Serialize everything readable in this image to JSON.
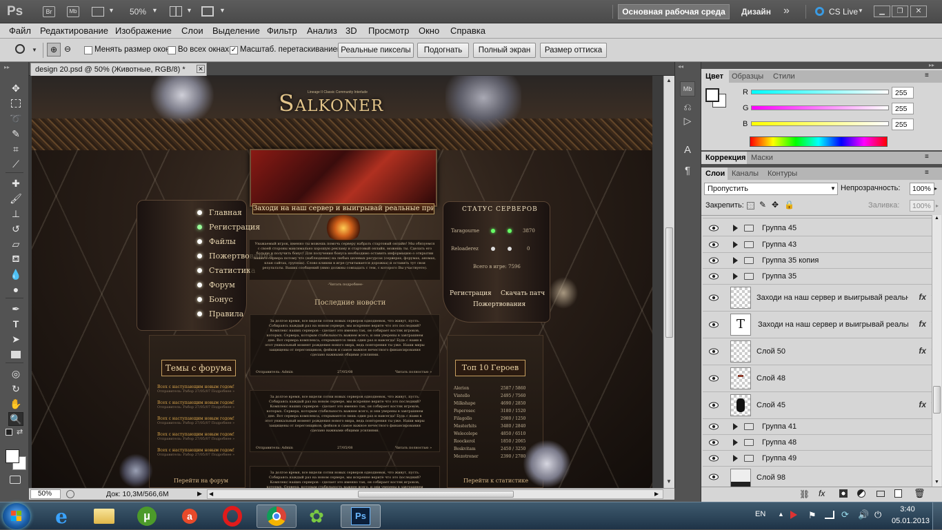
{
  "app": {
    "logo": "Ps",
    "bridge": "Br",
    "minibridge": "Mb",
    "zoom": "50%",
    "workspace_primary": "Основная рабочая среда",
    "workspace_secondary": "Дизайн",
    "cs_live": "CS Live"
  },
  "menu": [
    "Файл",
    "Редактирование",
    "Изображение",
    "Слои",
    "Выделение",
    "Фильтр",
    "Анализ",
    "3D",
    "Просмотр",
    "Окно",
    "Справка"
  ],
  "options": {
    "resize_windows": "Менять размер окон",
    "all_windows": "Во всех окнах",
    "scrubby_zoom": "Масштаб. перетаскиванием",
    "scrubby_checked": true,
    "btn_actual": "Реальные пикселы",
    "btn_fit": "Подогнать",
    "btn_fill": "Полный экран",
    "btn_print": "Размер оттиска"
  },
  "document": {
    "tab_title": "design 20.psd @ 50% (Животные, RGB/8) *",
    "zoom": "50%",
    "doc_size": "Док: 10,3M/566,6M"
  },
  "site": {
    "logo": "Salkoner",
    "tagline": "Lineage II Classic Community Interlude",
    "banner": "Заходи на наш сервер и выигрывай реальные призы!",
    "nav": [
      "Главная",
      "Регистрация",
      "Файлы",
      "Пожертвования",
      "Статистика",
      "Форум",
      "Бонус",
      "Правила"
    ],
    "welcome_text": "Уважаемый игрок, именно ты можешь помочь серверу набрать стартовый онлайн! Мы обязуемся с своей стороны максимально хорошую рекламу и стартовый онлайн, можешь ты. Сделать его больше и получить бонус! Для получения бонуса необходимо оставить информацию о открытии нашего сервера потому что (наблюдение) на любых целевых ресурсах (серверах, форумах, аномах, клан сайтах, группах). Слово кликни в игре (учитывается дорожка) и оставить тут свои результаты. Ваших сообщений (явно должны совпадать с тем, с которого Вы участвуете).",
    "read_more": "-Читать подробнее-",
    "news_title": "Последние новости",
    "news_text": "За долгое время, все видели сотни новых серверов однодневок, что живут, пусть. Собираясь каждый раз на новом сервере, мы искренне верите что это последний? Комплекс наших серверов - сделает это именно так, он собирает костяк игроков, которых. Сервера, которым стабильность важнее всего, и они уверены в завтрашнем дне. Вот сервера комплекса, открываются лишь один раз и навсегда! Будь с нами в этот уникальный момент рождения нового мира, ведь повторения ты уже. Наши миры защищены от перегонщиков, фейков и самое важное нечестного финансирования сделано важными общими усилиями.",
    "news_meta": [
      "Отправитель: Admin",
      "27/05/08",
      "Читать полностью »"
    ],
    "forum_title": "Темы с форума",
    "forum_topic": "Всех с наступающим новым годом!",
    "forum_meta": "Отправитель: Рабор    27/05/07    Подробнее »",
    "forum_link": "Перейти на форум",
    "status_title": "Статус серверов",
    "servers": [
      {
        "name": "Taragourne",
        "count": "3870"
      },
      {
        "name": "Reloaderez",
        "count": "0"
      }
    ],
    "total_online": "Всего в игре:  7596",
    "reg_link": "Регистрация",
    "patch_link": "Скачать патч",
    "donate_link": "Пожертвования",
    "top_title": "Топ 10 Героев",
    "top": [
      {
        "name": "Alerion",
        "score": "2587 / 5860"
      },
      {
        "name": "Vintello",
        "score": "2495 / 7560"
      },
      {
        "name": "Milkshape",
        "score": "4690 / 2850"
      },
      {
        "name": "Paperosec",
        "score": "3180 / 1520"
      },
      {
        "name": "Filagollo",
        "score": "2980 / 1250"
      },
      {
        "name": "Masterhits",
        "score": "3480 / 2840"
      },
      {
        "name": "Welecolepe",
        "score": "4850 / 6510"
      },
      {
        "name": "Roockerol",
        "score": "1850 / 2065"
      },
      {
        "name": "Beskvitam",
        "score": "2450 / 3250"
      },
      {
        "name": "Mezotroner",
        "score": "2390 / 2780"
      }
    ],
    "stats_link": "Перейти к статистике"
  },
  "color_panel": {
    "tabs": [
      "Цвет",
      "Образцы",
      "Стили"
    ],
    "r_label": "R",
    "r": "255",
    "g_label": "G",
    "g": "255",
    "b_label": "B",
    "b": "255"
  },
  "adjust_panel": {
    "tabs": [
      "Коррекция",
      "Маски"
    ]
  },
  "layers_panel": {
    "tabs": [
      "Слои",
      "Каналы",
      "Контуры"
    ],
    "blend_mode": "Пропустить",
    "opacity_label": "Непрозрачность:",
    "opacity": "100%",
    "lock_label": "Закрепить:",
    "fill_label": "Заливка:",
    "fill": "100%",
    "layers": [
      {
        "name": "Группа 45",
        "type": "group"
      },
      {
        "name": "Группа 43",
        "type": "group"
      },
      {
        "name": "Группа 35 копия",
        "type": "group"
      },
      {
        "name": "Группа 35",
        "type": "group"
      },
      {
        "name": "Заходи на наш сервер и выигрывай реальн...",
        "type": "raster",
        "fx": true
      },
      {
        "name": "Заходи на наш сервер и выигрывай реальн...",
        "type": "text",
        "fx": true
      },
      {
        "name": "Слой 50",
        "type": "raster",
        "fx": true
      },
      {
        "name": "Слой 48",
        "type": "raster",
        "fx": false
      },
      {
        "name": "Слой 45",
        "type": "raster",
        "fx": true
      },
      {
        "name": "Группа 41",
        "type": "group"
      },
      {
        "name": "Группа 48",
        "type": "group"
      },
      {
        "name": "Группа 49",
        "type": "group"
      },
      {
        "name": "Слой 98",
        "type": "raster",
        "fx": false
      }
    ],
    "fx_label": "fx"
  },
  "taskbar": {
    "lang": "EN",
    "time": "3:40",
    "date": "05.01.2013"
  },
  "colors": {
    "accent": "#1e6bd6",
    "site_gold": "#e8c67a",
    "ps_blue": "#0b1f3a"
  }
}
